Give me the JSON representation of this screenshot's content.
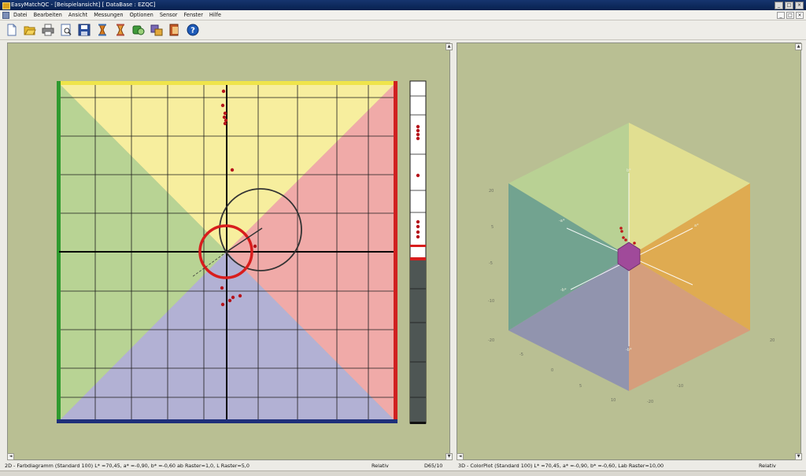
{
  "window": {
    "title": "EasyMatchQC - [Beispielansicht]   [ DataBase : EZQC]",
    "minimize": "_",
    "maximize": "□",
    "close": "×"
  },
  "menu": {
    "items": [
      "Datei",
      "Bearbeiten",
      "Ansicht",
      "Messungen",
      "Optionen",
      "Sensor",
      "Fenster",
      "Hilfe"
    ]
  },
  "toolbar": {
    "buttons": [
      {
        "name": "new-icon",
        "color": "#ffffff"
      },
      {
        "name": "open-folder-icon",
        "color": "#e5b82e"
      },
      {
        "name": "print-icon",
        "color": "#5a5a5a"
      },
      {
        "name": "print-preview-icon",
        "color": "#7a7a7a"
      },
      {
        "name": "save-icon",
        "color": "#2b4f9d"
      },
      {
        "name": "measure-standard-icon",
        "color": "#d87a1c"
      },
      {
        "name": "measure-sample-icon",
        "color": "#d87a1c"
      },
      {
        "name": "sensor-icon",
        "color": "#3f9a3a"
      },
      {
        "name": "settings-icon",
        "color": "#7b6ab6"
      },
      {
        "name": "export-icon",
        "color": "#c45a27"
      },
      {
        "name": "help-icon",
        "color": "#1e5bb8"
      }
    ]
  },
  "left_pane": {
    "status": {
      "description": "2D - Farbdiagramm (Standard 100) L* =70,45, a* =-0,90, b* =-0,60    ab Raster=1,0, L Raster=5,0",
      "mode": "Relativ",
      "illuminant": "D65/10"
    },
    "colors": {
      "yellow": "#f7ee9e",
      "green": "#b8d394",
      "red": "#f0aaa8",
      "blue": "#b2b1d4",
      "ring": "#d81d1d"
    }
  },
  "right_pane": {
    "status": {
      "description": "3D - ColorPlot (Standard 100) L* =70,45, a* =-0,90, b* =-0,60, Lab Raster=10,00",
      "mode": "Relativ"
    },
    "axis_labels": {
      "left_ticks": [
        "20",
        "5",
        "-5",
        "-10",
        "-20"
      ],
      "bottom_ticks": [
        "-5",
        "0",
        "5",
        "-10",
        "10",
        "-20",
        "20"
      ],
      "axis_a": "a*",
      "axis_b": "b*",
      "axis_minus_a": "-a*",
      "axis_minus_b": "-b*"
    }
  }
}
